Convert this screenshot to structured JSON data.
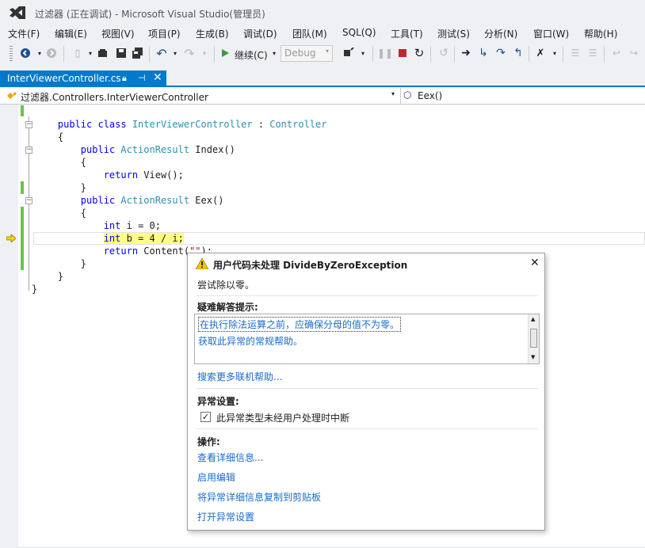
{
  "window": {
    "title": "过滤器 (正在调试) - Microsoft Visual Studio(管理员)"
  },
  "menu": [
    "文件(F)",
    "编辑(E)",
    "视图(V)",
    "项目(P)",
    "生成(B)",
    "调试(D)",
    "团队(M)",
    "SQL(Q)",
    "工具(T)",
    "测试(S)",
    "分析(N)",
    "窗口(W)",
    "帮助(H)"
  ],
  "toolbar": {
    "continue_label": "继续(C)",
    "config_value": "Debug"
  },
  "tabs": [
    {
      "label": "InterViewerController.cs"
    }
  ],
  "nav": {
    "type_scope": "过滤器.Controllers.InterViewerController",
    "member": "Eex()"
  },
  "code": {
    "line1": {
      "kw": "public class ",
      "type": "InterViewerController",
      "sep": " : ",
      "base": "Controller"
    },
    "line2": "{",
    "line3": {
      "kw": "public ",
      "type": "ActionResult",
      "rest": " Index()"
    },
    "line4": "{",
    "line5": {
      "kw": "return ",
      "rest": "View();"
    },
    "line6": "}",
    "line7": {
      "kw": "public ",
      "type": "ActionResult",
      "rest": " Eex()"
    },
    "line8": "{",
    "line9": {
      "kw": "int",
      "rest": " i = 0;"
    },
    "line10": {
      "kw": "int",
      "rest": " b = 4 / i;"
    },
    "line11": {
      "kw": "return ",
      "rest": "Content(",
      "str": "\"\"",
      "end": ");"
    },
    "line12": "}",
    "line13": "}",
    "line14": "}"
  },
  "exception": {
    "title": "用户代码未处理 DivideByZeroException",
    "description": "尝试除以零。",
    "tips_heading": "疑难解答提示:",
    "tips": [
      "在执行除法运算之前，应确保分母的值不为零。",
      "获取此异常的常规帮助。"
    ],
    "search_link": "搜索更多联机帮助...",
    "settings_heading": "异常设置:",
    "break_checkbox_label": "此异常类型未经用户处理时中断",
    "actions_heading": "操作:",
    "actions": [
      "查看详细信息...",
      "启用编辑",
      "将异常详细信息复制到剪贴板",
      "打开异常设置"
    ]
  }
}
